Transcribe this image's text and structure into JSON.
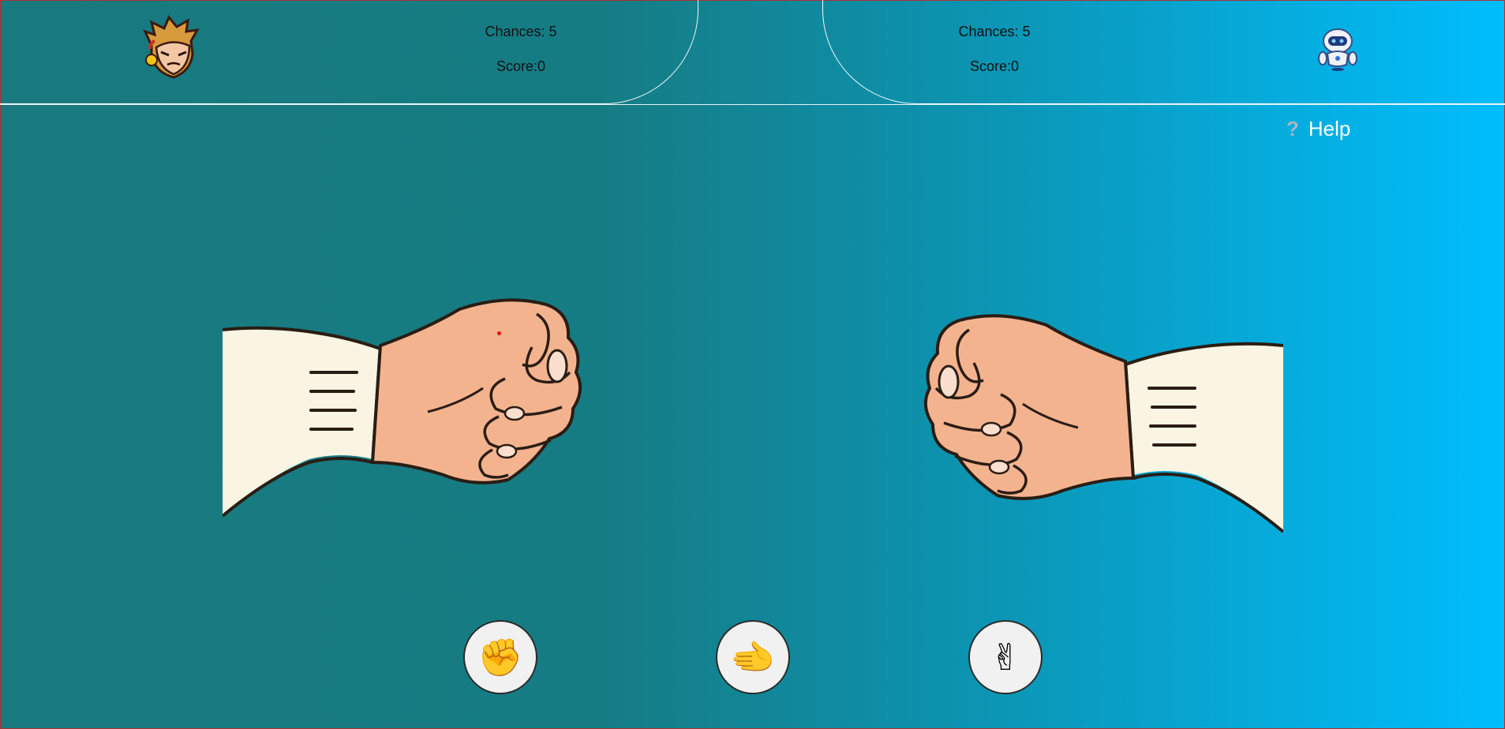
{
  "player": {
    "avatar_icon": "boy-avatar-icon",
    "chances_label": "Chances: 5",
    "score_label": "Score:0"
  },
  "computer": {
    "avatar_icon": "robot-avatar-icon",
    "chances_label": "Chances: 5",
    "score_label": "Score:0"
  },
  "help": {
    "icon": "question-icon",
    "label": "Help"
  },
  "hands": {
    "player_hand": "rock-fist-icon",
    "computer_hand": "rock-fist-icon"
  },
  "choices": [
    {
      "name": "rock",
      "glyph": "✊"
    },
    {
      "name": "paper",
      "glyph": "🫲"
    },
    {
      "name": "scissors",
      "glyph": "✌"
    }
  ],
  "colors": {
    "bg_left": "#187a7e",
    "bg_right": "#00bdfc",
    "skin": "#f4b38f",
    "sleeve": "#faf4e3",
    "outline": "#2a1d14"
  }
}
